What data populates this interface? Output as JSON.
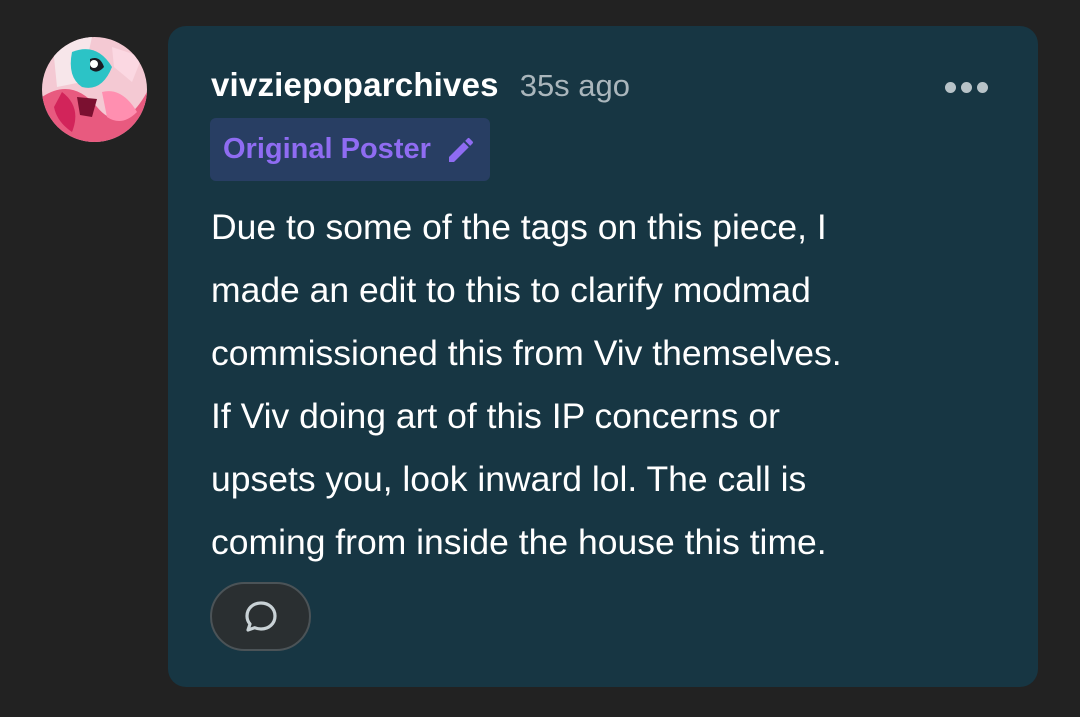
{
  "comment": {
    "username": "vivziepoparchives",
    "timestamp": "35s ago",
    "badge": {
      "label": "Original Poster",
      "icon": "pencil-icon",
      "color": "#8f6cf2"
    },
    "body_lines": [
      "Due to some of the tags on this piece, I",
      "made an edit to this to clarify modmad",
      "commissioned this from Viv themselves.",
      "If Viv doing art of this IP concerns or",
      "upsets you, look inward lol. The call is",
      "coming from inside the house this time."
    ],
    "more_icon": "ellipsis-icon",
    "reply_icon": "speech-bubble-icon"
  },
  "colors": {
    "background": "#222222",
    "card": "#173643",
    "badge_bg": "#283e63",
    "text": "#ffffff",
    "muted": "#aab6bc"
  }
}
